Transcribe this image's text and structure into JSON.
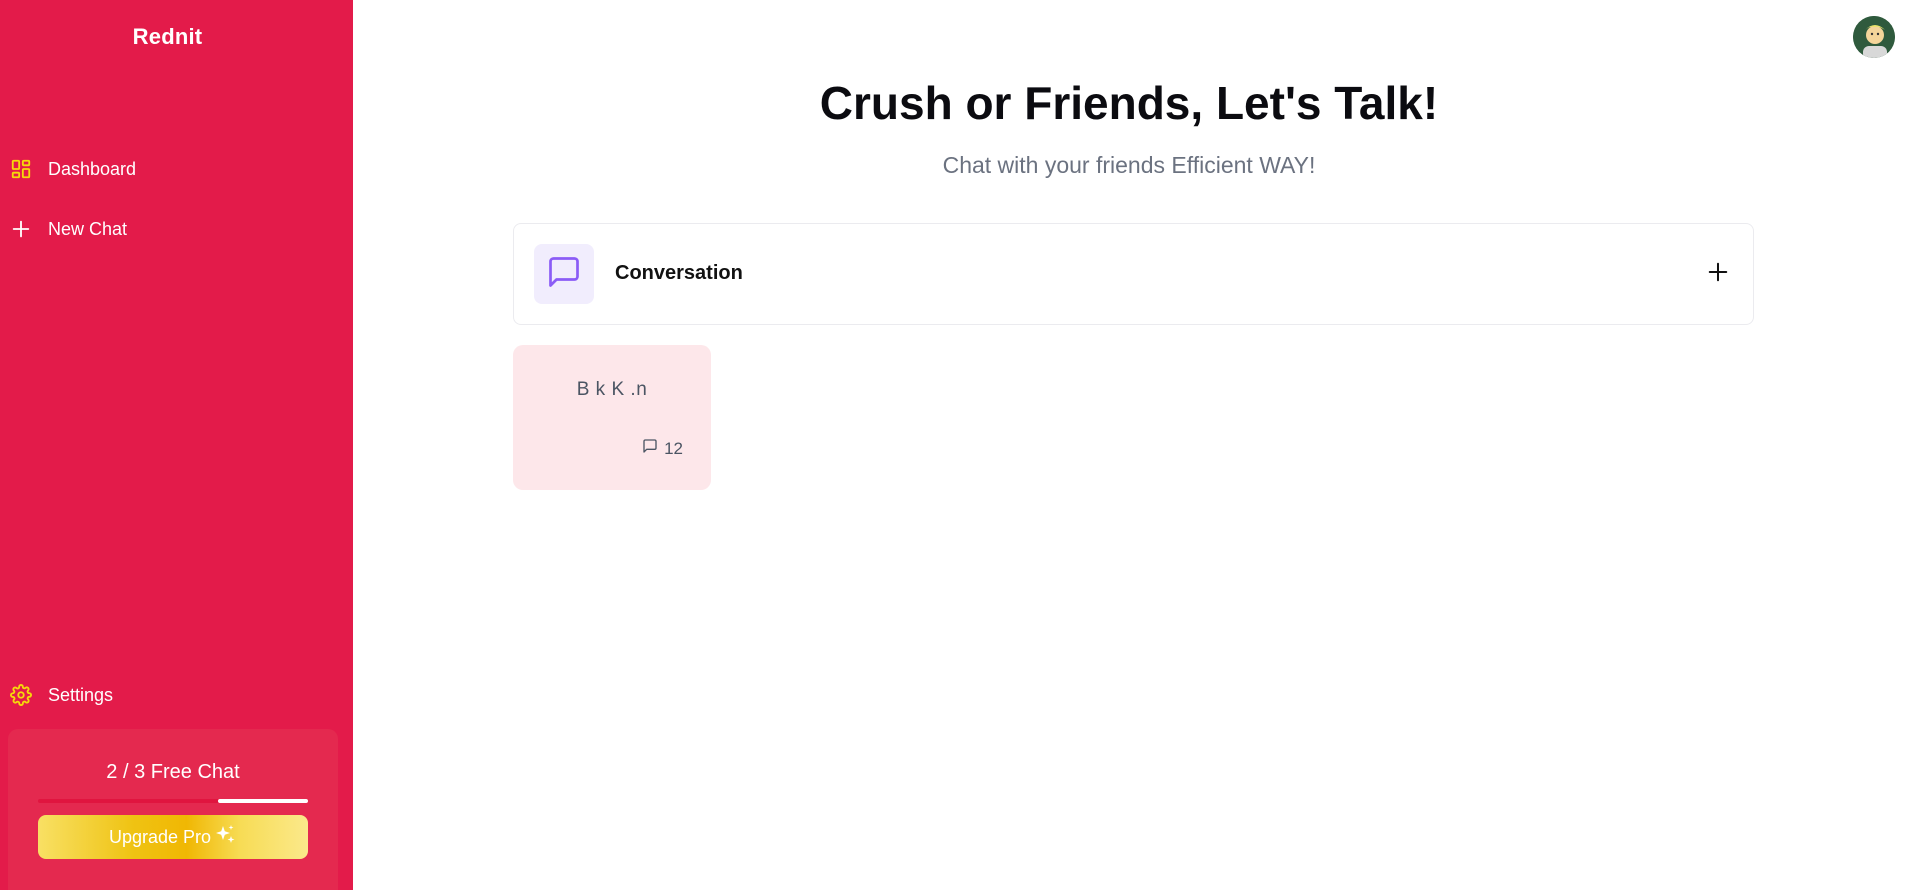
{
  "sidebar": {
    "brand": "Rednit",
    "items": [
      {
        "label": "Dashboard",
        "icon": "dashboard-icon"
      },
      {
        "label": "New Chat",
        "icon": "plus-icon"
      }
    ],
    "settings": {
      "label": "Settings",
      "icon": "gear-icon"
    },
    "plan": {
      "used": 2,
      "total": 3,
      "text": "2 / 3 Free Chat",
      "progress_fraction": 0.3333,
      "upgrade_label": "Upgrade Pro",
      "upgrade_icon": "sparkles-icon"
    }
  },
  "header": {
    "avatar_icon": "user-avatar"
  },
  "main": {
    "title": "Crush or Friends, Let's Talk!",
    "subtitle": "Chat with your friends Efficient WAY!",
    "conversation": {
      "label": "Conversation",
      "icon": "message-square-icon",
      "action_icon": "plus-icon"
    },
    "chats": [
      {
        "name": "B   k K   .n",
        "message_count": "12",
        "count_icon": "message-icon"
      }
    ]
  },
  "colors": {
    "sidebar_bg": "#e31b4a",
    "accent_purple": "#8b5cf6",
    "icon_yellow": "#f5d90a",
    "card_pink": "#fde7ea"
  }
}
